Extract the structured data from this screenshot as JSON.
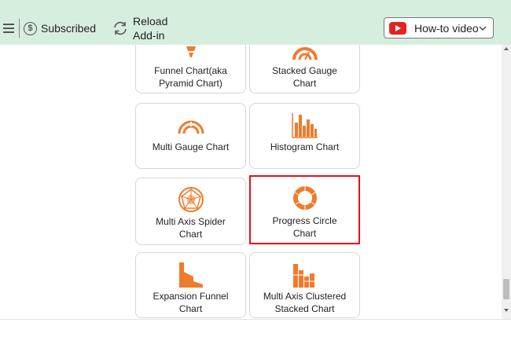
{
  "toolbar": {
    "subscribed_label": "Subscribed",
    "subscribed_icon": "dollar-circle-icon",
    "reload_line1": "Reload",
    "reload_line2": "Add-in",
    "howto_label": "How-to video"
  },
  "cards": [
    {
      "line1": "Funnel Chart(aka",
      "line2": "Pyramid Chart)"
    },
    {
      "line1": "Stacked Gauge",
      "line2": "Chart"
    },
    {
      "line1": "Multi Gauge Chart",
      "line2": ""
    },
    {
      "line1": "Histogram Chart",
      "line2": ""
    },
    {
      "line1": "Multi Axis Spider",
      "line2": "Chart"
    },
    {
      "line1": "Progress Circle",
      "line2": "Chart"
    },
    {
      "line1": "Expansion Funnel",
      "line2": "Chart"
    },
    {
      "line1": "Multi Axis Clustered",
      "line2": "Stacked Chart"
    }
  ],
  "colors": {
    "accent": "#ef7b2c",
    "selection": "#e8101a",
    "toolbar_bg": "#d6eede"
  }
}
